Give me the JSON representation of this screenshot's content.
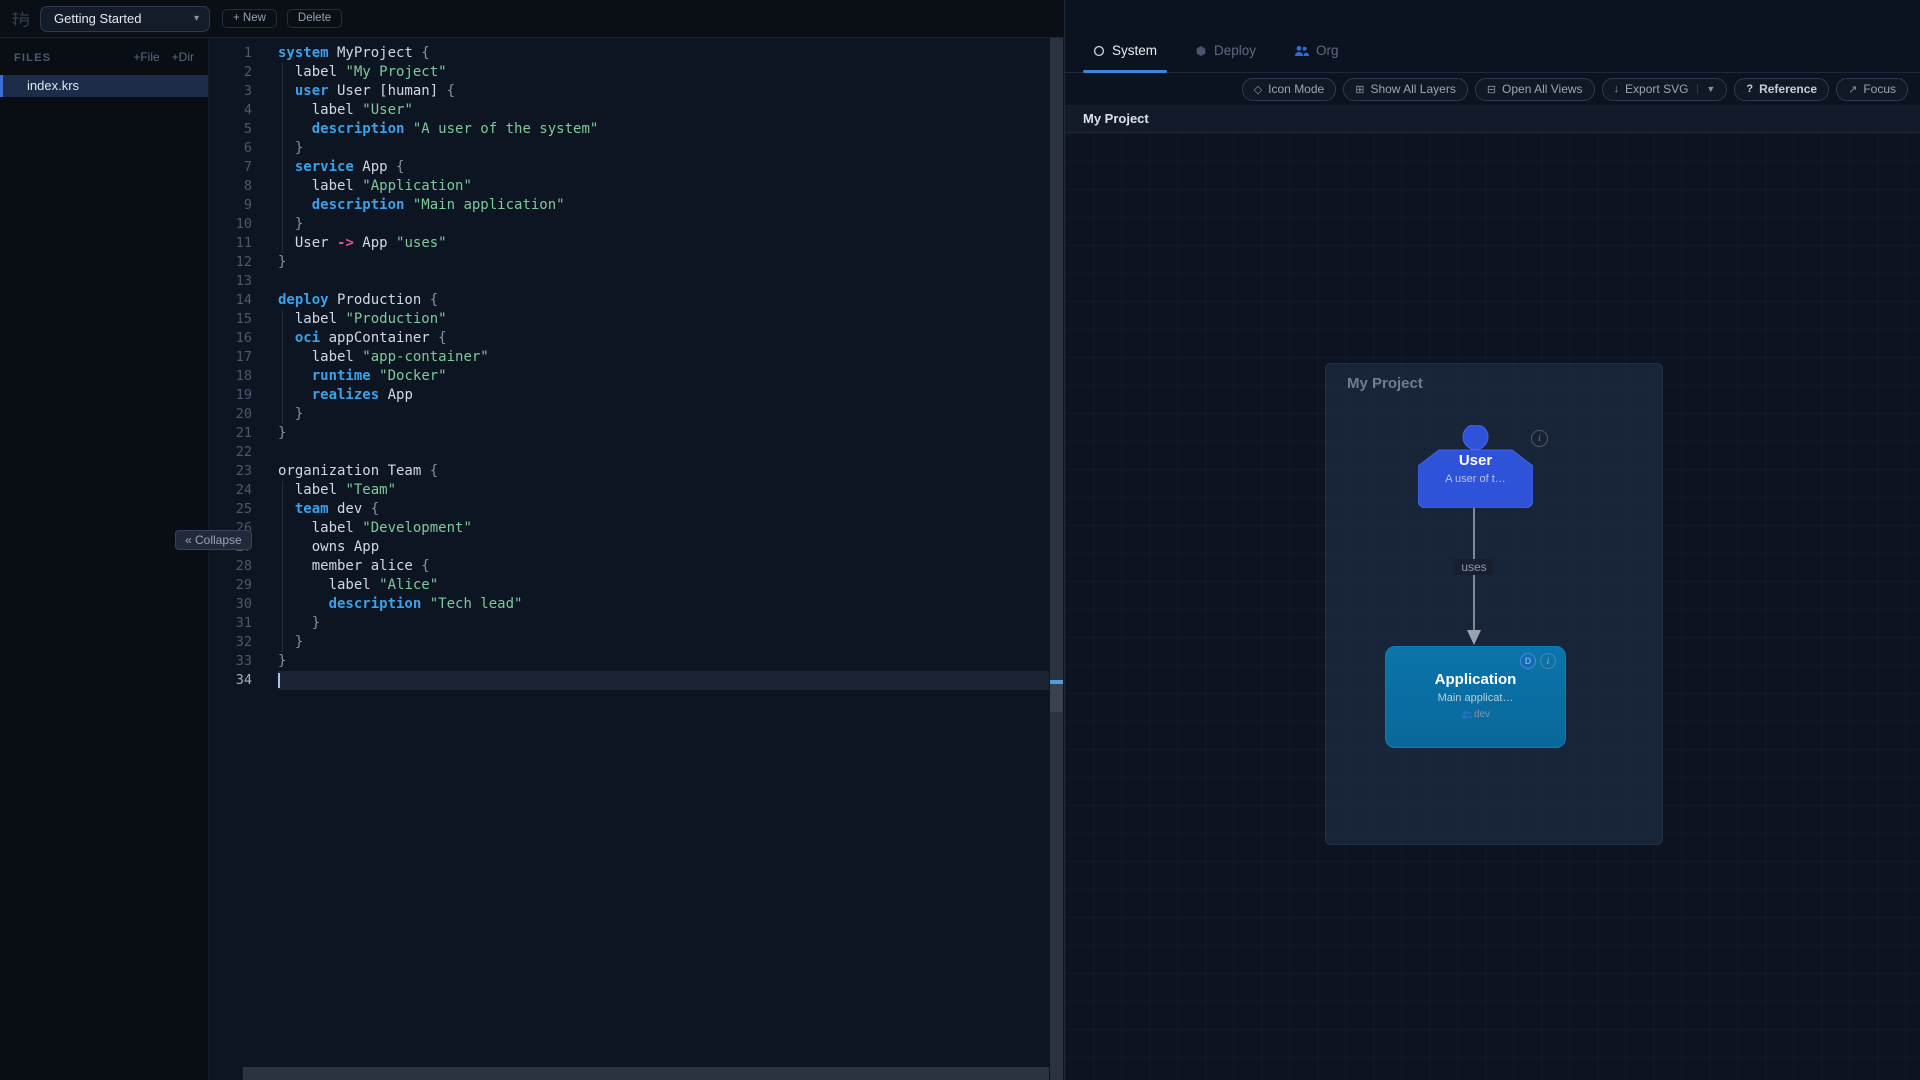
{
  "topbar": {
    "logo_icon": "鴉",
    "project_select": {
      "value": "Getting Started",
      "chevron": "▾"
    },
    "new_button": "+ New",
    "delete_button": "Delete"
  },
  "sidebar": {
    "files_header": "FILES",
    "add_file_button": "+File",
    "add_dir_button": "+Dir",
    "files": [
      {
        "name": "index.krs",
        "selected": true
      }
    ],
    "collapse_button": "« Collapse"
  },
  "editor": {
    "lines": [
      {
        "n": 1,
        "g": 0,
        "seg": [
          [
            "kw",
            "system"
          ],
          [
            "pl",
            " MyProject "
          ],
          [
            "pu",
            "{"
          ]
        ]
      },
      {
        "n": 2,
        "g": 1,
        "seg": [
          [
            "pl",
            "  label "
          ],
          [
            "str",
            "\"My Project\""
          ]
        ]
      },
      {
        "n": 3,
        "g": 1,
        "seg": [
          [
            "pl",
            "  "
          ],
          [
            "kw",
            "user"
          ],
          [
            "pl",
            " User [human] "
          ],
          [
            "pu",
            "{"
          ]
        ]
      },
      {
        "n": 4,
        "g": 1,
        "seg": [
          [
            "pl",
            "    label "
          ],
          [
            "str",
            "\"User\""
          ]
        ]
      },
      {
        "n": 5,
        "g": 1,
        "seg": [
          [
            "pl",
            "    "
          ],
          [
            "kw",
            "description"
          ],
          [
            "pl",
            " "
          ],
          [
            "str",
            "\"A user of the system\""
          ]
        ]
      },
      {
        "n": 6,
        "g": 1,
        "seg": [
          [
            "pl",
            "  "
          ],
          [
            "pu",
            "}"
          ]
        ]
      },
      {
        "n": 7,
        "g": 1,
        "seg": [
          [
            "pl",
            "  "
          ],
          [
            "kw",
            "service"
          ],
          [
            "pl",
            " App "
          ],
          [
            "pu",
            "{"
          ]
        ]
      },
      {
        "n": 8,
        "g": 1,
        "seg": [
          [
            "pl",
            "    label "
          ],
          [
            "str",
            "\"Application\""
          ]
        ]
      },
      {
        "n": 9,
        "g": 1,
        "seg": [
          [
            "pl",
            "    "
          ],
          [
            "kw",
            "description"
          ],
          [
            "pl",
            " "
          ],
          [
            "str",
            "\"Main application\""
          ]
        ]
      },
      {
        "n": 10,
        "g": 1,
        "seg": [
          [
            "pl",
            "  "
          ],
          [
            "pu",
            "}"
          ]
        ]
      },
      {
        "n": 11,
        "g": 1,
        "seg": [
          [
            "pl",
            "  User "
          ],
          [
            "op",
            "->"
          ],
          [
            "pl",
            " App "
          ],
          [
            "str",
            "\"uses\""
          ]
        ]
      },
      {
        "n": 12,
        "g": 0,
        "seg": [
          [
            "pu",
            "}"
          ]
        ]
      },
      {
        "n": 13,
        "g": 0,
        "seg": []
      },
      {
        "n": 14,
        "g": 0,
        "seg": [
          [
            "kw",
            "deploy"
          ],
          [
            "pl",
            " Production "
          ],
          [
            "pu",
            "{"
          ]
        ]
      },
      {
        "n": 15,
        "g": 1,
        "seg": [
          [
            "pl",
            "  label "
          ],
          [
            "str",
            "\"Production\""
          ]
        ]
      },
      {
        "n": 16,
        "g": 1,
        "seg": [
          [
            "pl",
            "  "
          ],
          [
            "kw",
            "oci"
          ],
          [
            "pl",
            " appContainer "
          ],
          [
            "pu",
            "{"
          ]
        ]
      },
      {
        "n": 17,
        "g": 1,
        "seg": [
          [
            "pl",
            "    label "
          ],
          [
            "str",
            "\"app-container\""
          ]
        ]
      },
      {
        "n": 18,
        "g": 1,
        "seg": [
          [
            "pl",
            "    "
          ],
          [
            "kw",
            "runtime"
          ],
          [
            "pl",
            " "
          ],
          [
            "str",
            "\"Docker\""
          ]
        ]
      },
      {
        "n": 19,
        "g": 1,
        "seg": [
          [
            "pl",
            "    "
          ],
          [
            "kw",
            "realizes"
          ],
          [
            "pl",
            " App"
          ]
        ]
      },
      {
        "n": 20,
        "g": 1,
        "seg": [
          [
            "pl",
            "  "
          ],
          [
            "pu",
            "}"
          ]
        ]
      },
      {
        "n": 21,
        "g": 0,
        "seg": [
          [
            "pu",
            "}"
          ]
        ]
      },
      {
        "n": 22,
        "g": 0,
        "seg": []
      },
      {
        "n": 23,
        "g": 0,
        "seg": [
          [
            "pl",
            "organization Team "
          ],
          [
            "pu",
            "{"
          ]
        ]
      },
      {
        "n": 24,
        "g": 1,
        "seg": [
          [
            "pl",
            "  label "
          ],
          [
            "str",
            "\"Team\""
          ]
        ]
      },
      {
        "n": 25,
        "g": 1,
        "seg": [
          [
            "pl",
            "  "
          ],
          [
            "kw",
            "team"
          ],
          [
            "pl",
            " dev "
          ],
          [
            "pu",
            "{"
          ]
        ]
      },
      {
        "n": 26,
        "g": 1,
        "seg": [
          [
            "pl",
            "    label "
          ],
          [
            "str",
            "\"Development\""
          ]
        ]
      },
      {
        "n": 27,
        "g": 1,
        "seg": [
          [
            "pl",
            "    owns App"
          ]
        ]
      },
      {
        "n": 28,
        "g": 1,
        "seg": [
          [
            "pl",
            "    member alice "
          ],
          [
            "pu",
            "{"
          ]
        ]
      },
      {
        "n": 29,
        "g": 1,
        "seg": [
          [
            "pl",
            "      label "
          ],
          [
            "str",
            "\"Alice\""
          ]
        ]
      },
      {
        "n": 30,
        "g": 1,
        "seg": [
          [
            "pl",
            "      "
          ],
          [
            "kw",
            "description"
          ],
          [
            "pl",
            " "
          ],
          [
            "str",
            "\"Tech lead\""
          ]
        ]
      },
      {
        "n": 31,
        "g": 1,
        "seg": [
          [
            "pl",
            "    "
          ],
          [
            "pu",
            "}"
          ]
        ]
      },
      {
        "n": 32,
        "g": 1,
        "seg": [
          [
            "pl",
            "  "
          ],
          [
            "pu",
            "}"
          ]
        ]
      },
      {
        "n": 33,
        "g": 0,
        "seg": [
          [
            "pu",
            "}"
          ]
        ]
      },
      {
        "n": 34,
        "g": 0,
        "active": true,
        "seg": []
      }
    ]
  },
  "panel": {
    "tabs": [
      {
        "label": "System",
        "icon": "circle-outline",
        "active": true
      },
      {
        "label": "Deploy",
        "icon": "hexagon",
        "active": false
      },
      {
        "label": "Org",
        "icon": "people",
        "active": false
      }
    ],
    "toolbar": [
      {
        "label": "Icon Mode",
        "icon": "◇"
      },
      {
        "label": "Show All Layers",
        "icon": "⊞"
      },
      {
        "label": "Open All Views",
        "icon": "⊟"
      },
      {
        "label": "Export SVG",
        "icon": "↓",
        "split_caret": "▼"
      },
      {
        "label": "Reference",
        "icon": "?",
        "bold": true
      },
      {
        "label": "Focus",
        "icon": "↗"
      }
    ],
    "breadcrumb": "My Project",
    "diagram": {
      "container_title": "My Project",
      "user_node": {
        "title": "User",
        "description": "A user of t…",
        "info_badge": "i"
      },
      "app_node": {
        "title": "Application",
        "description": "Main applicat…",
        "deploy_badge": "D",
        "info_badge": "i",
        "team_badge": "dev"
      },
      "edge_label": "uses"
    }
  },
  "colors": {
    "accent_blue": "#3d86dc",
    "person_node_blue": "#2e52d8",
    "service_node_teal": "#0a6fa3",
    "keyword": "#3ba1e8",
    "string": "#7bcb9b",
    "operator": "#e0558c",
    "selected_file_bg": "#1c2c49"
  }
}
